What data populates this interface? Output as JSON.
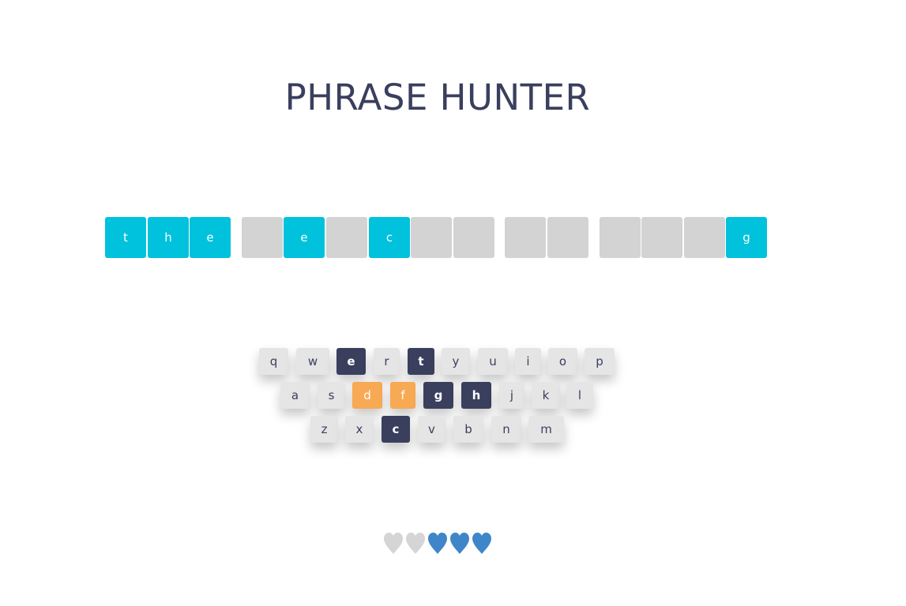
{
  "title": "PHRASE HUNTER",
  "phrase": [
    {
      "ch": "t",
      "shown": true
    },
    {
      "ch": "h",
      "shown": true
    },
    {
      "ch": "e",
      "shown": true
    },
    {
      "ch": "",
      "shown": false
    },
    {
      "ch": "e",
      "shown": true
    },
    {
      "ch": "",
      "shown": false
    },
    {
      "ch": "c",
      "shown": true
    },
    {
      "ch": "",
      "shown": false
    },
    {
      "ch": "",
      "shown": false
    },
    {
      "ch": "",
      "shown": false
    },
    {
      "ch": "",
      "shown": false
    },
    {
      "ch": "",
      "shown": false
    },
    {
      "ch": "",
      "shown": false
    },
    {
      "ch": "",
      "shown": false
    },
    {
      "ch": "g",
      "shown": true
    }
  ],
  "keyboard": {
    "row1": [
      {
        "label": "q",
        "state": "default"
      },
      {
        "label": "w",
        "state": "default"
      },
      {
        "label": "e",
        "state": "chosen"
      },
      {
        "label": "r",
        "state": "default"
      },
      {
        "label": "t",
        "state": "chosen"
      },
      {
        "label": "y",
        "state": "default"
      },
      {
        "label": "u",
        "state": "default"
      },
      {
        "label": "i",
        "state": "default"
      },
      {
        "label": "o",
        "state": "default"
      },
      {
        "label": "p",
        "state": "default"
      }
    ],
    "row2": [
      {
        "label": "a",
        "state": "default"
      },
      {
        "label": "s",
        "state": "default"
      },
      {
        "label": "d",
        "state": "wrong"
      },
      {
        "label": "f",
        "state": "wrong"
      },
      {
        "label": "g",
        "state": "chosen"
      },
      {
        "label": "h",
        "state": "chosen"
      },
      {
        "label": "j",
        "state": "default"
      },
      {
        "label": "k",
        "state": "default"
      },
      {
        "label": "l",
        "state": "default"
      }
    ],
    "row3": [
      {
        "label": "z",
        "state": "default"
      },
      {
        "label": "x",
        "state": "default"
      },
      {
        "label": "c",
        "state": "chosen"
      },
      {
        "label": "v",
        "state": "default"
      },
      {
        "label": "b",
        "state": "default"
      },
      {
        "label": "n",
        "state": "default"
      },
      {
        "label": "m",
        "state": "default"
      }
    ]
  },
  "lives": [
    {
      "state": "lost",
      "icon": "heart-icon"
    },
    {
      "state": "lost",
      "icon": "heart-icon"
    },
    {
      "state": "live",
      "icon": "heart-icon"
    },
    {
      "state": "live",
      "icon": "heart-icon"
    },
    {
      "state": "live",
      "icon": "heart-icon"
    }
  ],
  "colors": {
    "title": "#3a3f5e",
    "tile_shown": "#00c2dc",
    "tile_hidden": "#d3d3d3",
    "key_default": "#e5e5e5",
    "key_chosen": "#3a3f5e",
    "key_wrong": "#f8a953",
    "heart_live": "#3f86c9",
    "heart_lost": "#d5d5d5"
  }
}
